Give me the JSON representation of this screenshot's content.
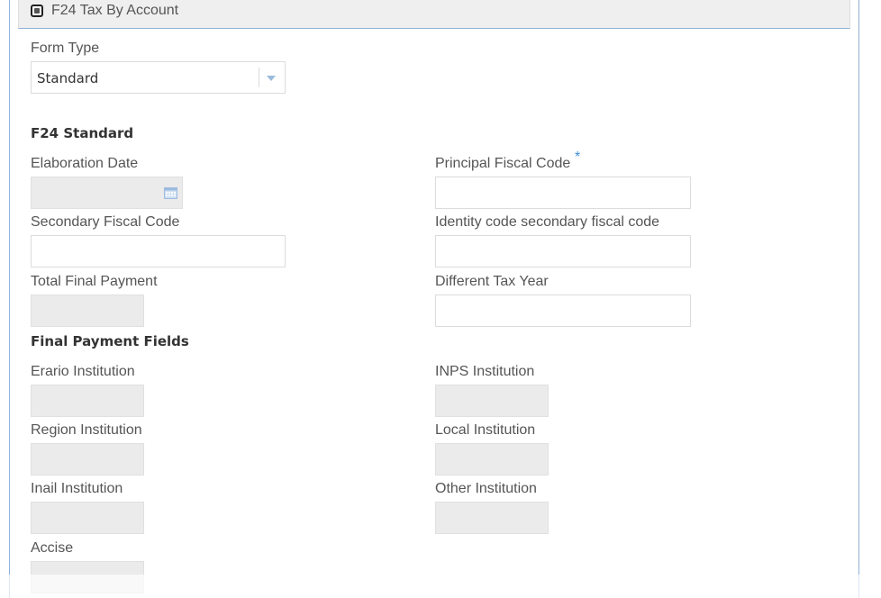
{
  "section": {
    "title": "F24 Tax By Account"
  },
  "form_type": {
    "label": "Form Type",
    "selected": "Standard"
  },
  "f24_standard": {
    "heading": "F24 Standard",
    "elaboration_date": {
      "label": "Elaboration Date",
      "value": ""
    },
    "principal_fiscal_code": {
      "label": "Principal Fiscal Code",
      "required_mark": "*",
      "value": ""
    },
    "secondary_fiscal_code": {
      "label": "Secondary Fiscal Code",
      "value": ""
    },
    "identity_code_secondary": {
      "label": "Identity code secondary fiscal code",
      "value": ""
    },
    "total_final_payment": {
      "label": "Total Final Payment",
      "value": ""
    },
    "different_tax_year": {
      "label": "Different Tax Year",
      "value": ""
    }
  },
  "final_payment_fields": {
    "heading": "Final Payment Fields",
    "erario_institution": {
      "label": "Erario Institution",
      "value": ""
    },
    "inps_institution": {
      "label": "INPS Institution",
      "value": ""
    },
    "region_institution": {
      "label": "Region Institution",
      "value": ""
    },
    "local_institution": {
      "label": "Local Institution",
      "value": ""
    },
    "inail_institution": {
      "label": "Inail Institution",
      "value": ""
    },
    "other_institution": {
      "label": "Other Institution",
      "value": ""
    },
    "accise": {
      "label": "Accise",
      "value": ""
    }
  },
  "colors": {
    "border_accent": "#8fb1d9",
    "required_star": "#3a8fd6",
    "disabled_field": "#ebebeb",
    "header_bg": "#efefef"
  },
  "icons": {
    "collapse": "collapse-toggle-icon",
    "calendar": "calendar-icon",
    "dropdown": "chevron-down-icon"
  }
}
